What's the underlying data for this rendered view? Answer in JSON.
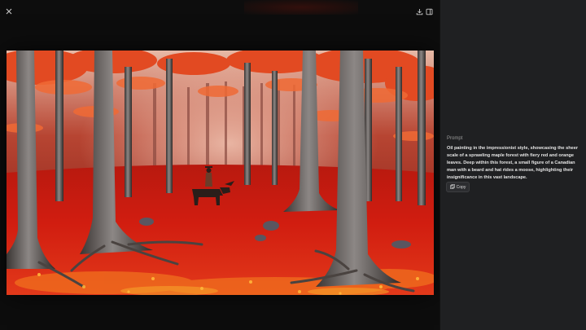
{
  "viewer": {
    "close_icon": "close-icon",
    "download_icon": "download-icon",
    "sidebar_icon": "sidebar-toggle-icon",
    "image_description_alt": "Oil painting in the impressionist style, showcasing the sheer scale of a sprawling maple forest with fiery red and orange leaves. Deep within this forest, a small figure of a Canadian man with a beard and hat rides a moose, highlighting their insignificance in this vast landscape."
  },
  "panel": {
    "prompt_label": "Prompt",
    "prompt_text": "Oil painting in the impressionist style, showcasing the sheer scale of a sprawling maple forest with fiery red and orange leaves. Deep within this forest, a small figure of a Canadian man with a beard and hat rides a moose, highlighting their insignificance in this vast landscape.",
    "copy_label": "Copy",
    "copy_icon": "copy-icon"
  },
  "colors": {
    "viewer_bg": "#0d0d0d",
    "panel_bg": "#1f2022",
    "forest_red": "#c8160c",
    "canopy_orange": "#e8502a"
  }
}
